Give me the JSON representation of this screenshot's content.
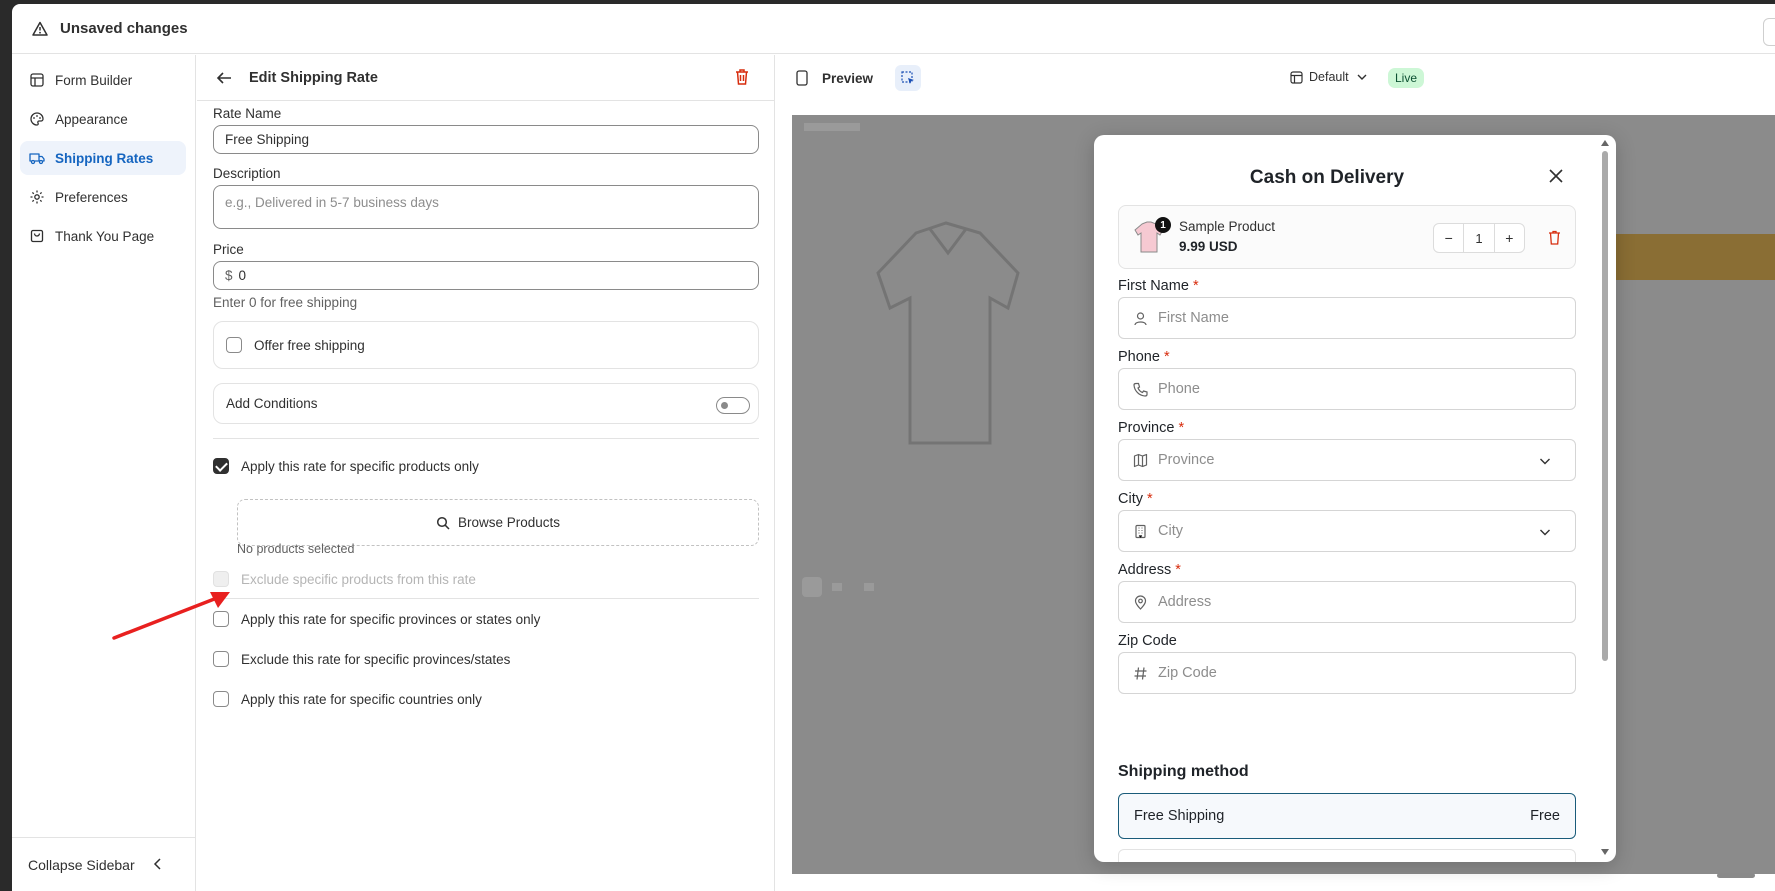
{
  "topbar": {
    "title": "Unsaved changes",
    "icon": "warning-icon"
  },
  "sidebar": {
    "items": [
      {
        "label": "Form Builder",
        "icon": "layout-icon",
        "active": false
      },
      {
        "label": "Appearance",
        "icon": "palette-icon",
        "active": false
      },
      {
        "label": "Shipping Rates",
        "icon": "truck-icon",
        "active": true
      },
      {
        "label": "Preferences",
        "icon": "gear-icon",
        "active": false
      },
      {
        "label": "Thank You Page",
        "icon": "bag-icon",
        "active": false
      }
    ],
    "collapse_label": "Collapse Sidebar"
  },
  "editor": {
    "title": "Edit Shipping Rate",
    "rate_name_label": "Rate Name",
    "rate_name_value": "Free Shipping",
    "description_label": "Description",
    "description_placeholder": "e.g., Delivered in 5-7 business days",
    "price_label": "Price",
    "price_currency": "$",
    "price_value": "0",
    "price_help": "Enter 0 for free shipping",
    "offer_free_label": "Offer free shipping",
    "offer_free_checked": false,
    "add_conditions_label": "Add Conditions",
    "add_conditions_on": false,
    "specific_products_label": "Apply this rate for specific products only",
    "specific_products_checked": true,
    "browse_label": "Browse Products",
    "no_products_label": "No products selected",
    "exclude_products_label": "Exclude specific products from this rate",
    "provinces_label": "Apply this rate for specific provinces or states only",
    "exclude_provinces_label": "Exclude this rate for specific provinces/states",
    "countries_label": "Apply this rate for specific countries only"
  },
  "preview": {
    "label": "Preview",
    "template_label": "Default",
    "status_label": "Live",
    "status_color": "#cdf7d6"
  },
  "modal": {
    "title": "Cash on Delivery",
    "product": {
      "name": "Sample Product",
      "price": "9.99 USD",
      "badge": "1",
      "quantity": "1",
      "minus": "−",
      "plus": "+"
    },
    "fields": [
      {
        "label": "First Name",
        "required": true,
        "placeholder": "First Name",
        "icon": "user-icon",
        "dropdown": false
      },
      {
        "label": "Phone",
        "required": true,
        "placeholder": "Phone",
        "icon": "phone-icon",
        "dropdown": false
      },
      {
        "label": "Province",
        "required": true,
        "placeholder": "Province",
        "icon": "map-icon",
        "dropdown": true
      },
      {
        "label": "City",
        "required": true,
        "placeholder": "City",
        "icon": "building-icon",
        "dropdown": true
      },
      {
        "label": "Address",
        "required": true,
        "placeholder": "Address",
        "icon": "pin-icon",
        "dropdown": false
      },
      {
        "label": "Zip Code",
        "required": false,
        "placeholder": "Zip Code",
        "icon": "hash-icon",
        "dropdown": false
      }
    ],
    "required_mark": "*",
    "shipping_title": "Shipping method",
    "shipping_option": {
      "name": "Free Shipping",
      "price": "Free"
    }
  },
  "colors": {
    "accent": "#1565c0",
    "danger": "#d72c0d",
    "annotation_arrow": "#e8201f"
  }
}
